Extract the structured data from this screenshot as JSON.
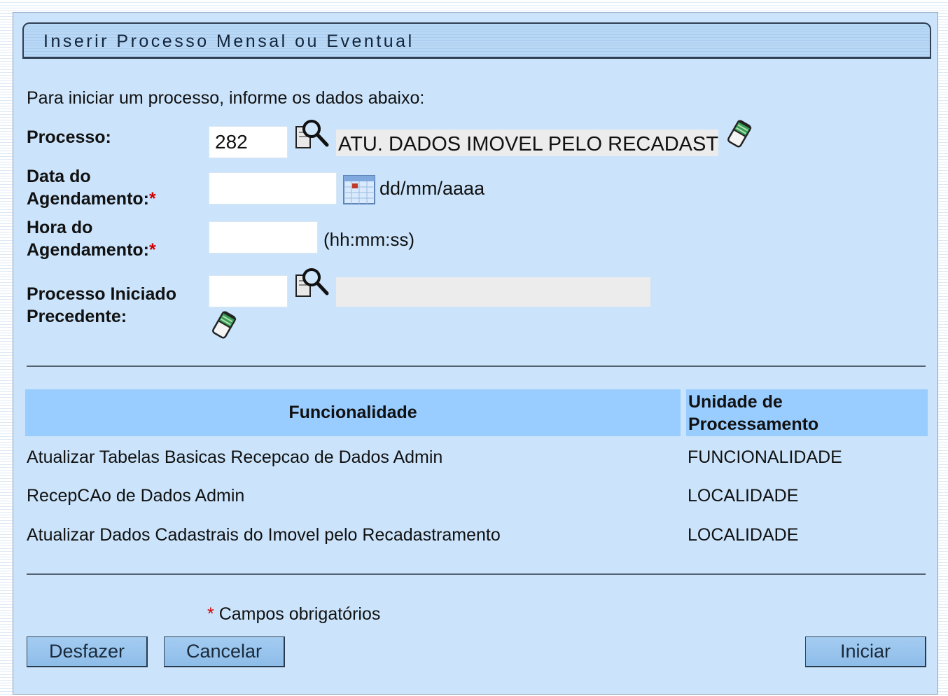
{
  "header": {
    "title": "Inserir Processo Mensal ou Eventual"
  },
  "intro": "Para iniciar um processo, informe os dados abaixo:",
  "form": {
    "processo": {
      "label": "Processo:",
      "value": "282",
      "description": "ATU. DADOS IMOVEL PELO RECADAST"
    },
    "data": {
      "label_line1": "Data do",
      "label_line2": "Agendamento:",
      "required_mark": "*",
      "value": "",
      "format_hint": "dd/mm/aaaa"
    },
    "hora": {
      "label_line1": "Hora do",
      "label_line2": "Agendamento:",
      "required_mark": "*",
      "value": "",
      "format_hint": "(hh:mm:ss)"
    },
    "precedente": {
      "label_line1": "Processo Iniciado",
      "label_line2": "Precedente:",
      "value": "",
      "description": ""
    }
  },
  "table": {
    "headers": {
      "funcionalidade": "Funcionalidade",
      "unidade_line1": "Unidade de",
      "unidade_line2": "Processamento"
    },
    "rows": [
      {
        "funcionalidade": "Atualizar Tabelas Basicas Recepcao de Dados Admin",
        "unidade": "FUNCIONALIDADE"
      },
      {
        "funcionalidade": "RecepCAo de Dados Admin",
        "unidade": "LOCALIDADE"
      },
      {
        "funcionalidade": "Atualizar Dados Cadastrais do Imovel pelo Recadastramento",
        "unidade": "LOCALIDADE"
      }
    ]
  },
  "footer": {
    "required_mark": "*",
    "required_note": "Campos obrigatórios",
    "desfazer": "Desfazer",
    "cancelar": "Cancelar",
    "iniciar": "Iniciar"
  },
  "icons": {
    "search": "search-icon",
    "eraser": "eraser-icon",
    "calendar": "calendar-icon"
  },
  "colors": {
    "panel_bg": "#cbe4fb",
    "table_header_bg": "#99ccff",
    "required": "#d40000",
    "button_bg": "#9ec8f0"
  }
}
